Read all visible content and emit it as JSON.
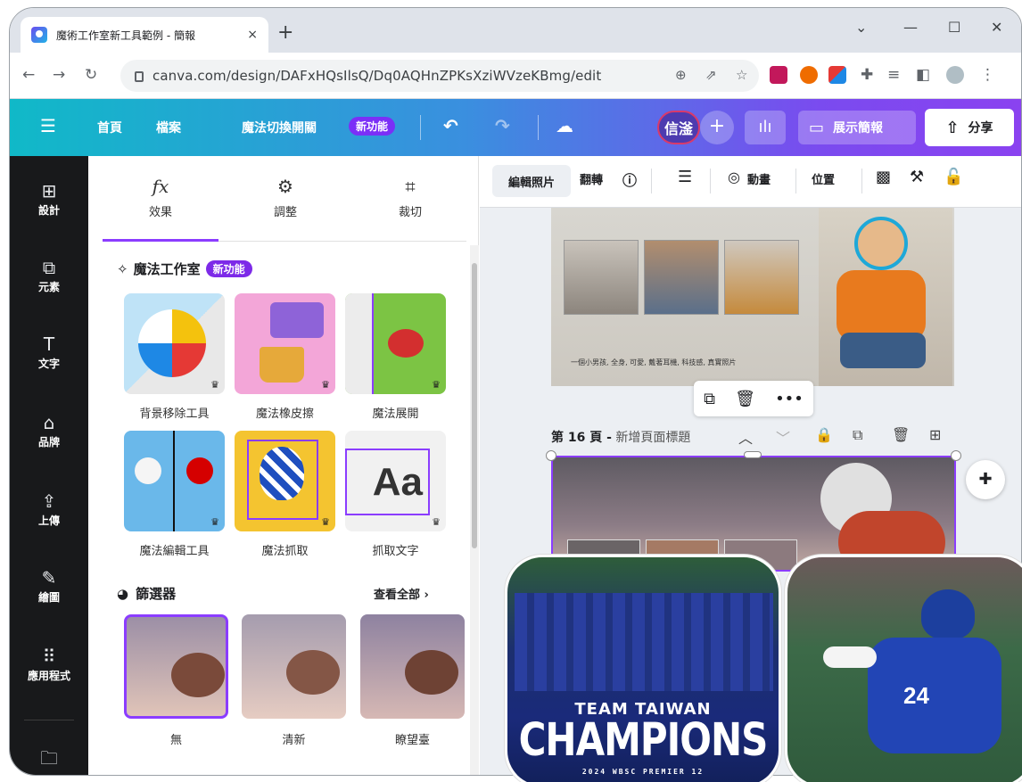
{
  "browser": {
    "tab_title": "魔術工作室新工具範例 - 簡報",
    "tab_close": "×",
    "new_tab": "+",
    "url": "canva.com/design/DAFxHQsIlsQ/Dq0AQHnZPKsXziWVzeKBmg/edit"
  },
  "header": {
    "home": "首頁",
    "file": "檔案",
    "magic_switch": "魔法切換開關",
    "new_badge": "新功能",
    "avatar_initials": "信滏",
    "present": "展示簡報",
    "share": "分享"
  },
  "rail": [
    {
      "glyph": "⊞",
      "label": "設計"
    },
    {
      "glyph": "⧉",
      "label": "元素"
    },
    {
      "glyph": "T",
      "label": "文字"
    },
    {
      "glyph": "⌂",
      "label": "品牌"
    },
    {
      "glyph": "⇪",
      "label": "上傳"
    },
    {
      "glyph": "✎",
      "label": "繪圖"
    },
    {
      "glyph": "⠿",
      "label": "應用程式"
    }
  ],
  "panel": {
    "tabs": [
      {
        "glyph": "fx",
        "label": "效果"
      },
      {
        "glyph": "⚙",
        "label": "調整"
      },
      {
        "glyph": "⌗",
        "label": "裁切"
      }
    ],
    "magic_studio": {
      "title": "魔法工作室",
      "badge": "新功能",
      "tools": [
        "背景移除工具",
        "魔法橡皮擦",
        "魔法展開",
        "魔法編輯工具",
        "魔法抓取",
        "抓取文字"
      ]
    },
    "filters": {
      "title": "篩選器",
      "see_all": "查看全部 ›",
      "items": [
        "無",
        "清新",
        "瞭望臺"
      ]
    }
  },
  "canvas_toolbar": {
    "edit_photo": "編輯照片",
    "flip": "翻轉",
    "animate": "動畫",
    "position": "位置"
  },
  "canvas": {
    "page15_caption": "一個小男孩, 全身, 可愛, 戴著耳機, 科技感, 真實照片",
    "page16_number": "第 16 頁 -",
    "page16_title": "新增頁面標題"
  },
  "overlay": {
    "team": "TEAM TAIWAN",
    "champions": "CHAMPIONS",
    "event": "2024 WBSC PREMIER 12",
    "jersey": "24"
  }
}
